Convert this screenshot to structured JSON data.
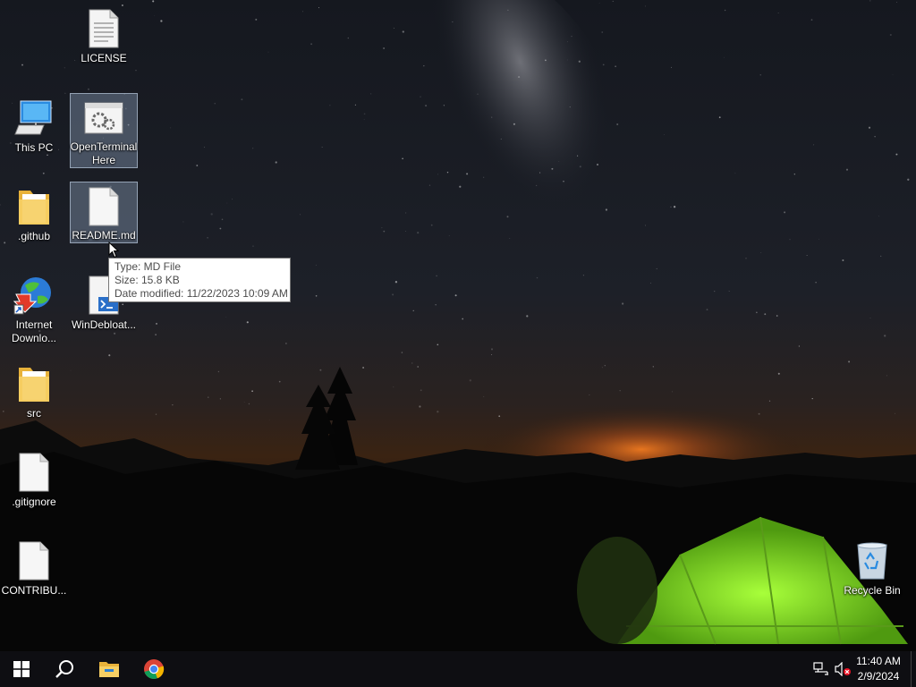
{
  "desktop": {
    "icons": [
      {
        "label": "LICENSE",
        "icon": "text-file-icon"
      },
      {
        "label": "This PC",
        "icon": "computer-icon"
      },
      {
        "label": "OpenTerminal Here",
        "icon": "batch-file-icon"
      },
      {
        "label": ".github",
        "icon": "folder-icon"
      },
      {
        "label": "README.md",
        "icon": "blank-file-icon"
      },
      {
        "label": "Internet Downlo...",
        "icon": "idm-icon"
      },
      {
        "label": "WinDebloat...",
        "icon": "script-icon"
      },
      {
        "label": "src",
        "icon": "folder-icon"
      },
      {
        "label": ".gitignore",
        "icon": "blank-file-icon"
      },
      {
        "label": "CONTRIBU...",
        "icon": "blank-file-icon"
      },
      {
        "label": "Recycle Bin",
        "icon": "recycle-bin-icon"
      }
    ],
    "selected": [
      "OpenTerminal Here",
      "README.md"
    ]
  },
  "tooltip": {
    "type": "Type: MD File",
    "size": "Size: 15.8 KB",
    "modified": "Date modified: 11/22/2023 10:09 AM"
  },
  "taskbar": {
    "buttons": [
      "windows-start-icon",
      "search-icon",
      "file-explorer-icon",
      "chrome-icon"
    ],
    "tray": [
      "network-icon",
      "volume-muted-icon"
    ],
    "time": "11:40 AM",
    "date": "2/9/2024"
  },
  "colors": {
    "taskbar": "#0e0e12",
    "selection": "#96aac8",
    "tent": "#7fd12a",
    "horizon_glow": "#e0661a"
  }
}
